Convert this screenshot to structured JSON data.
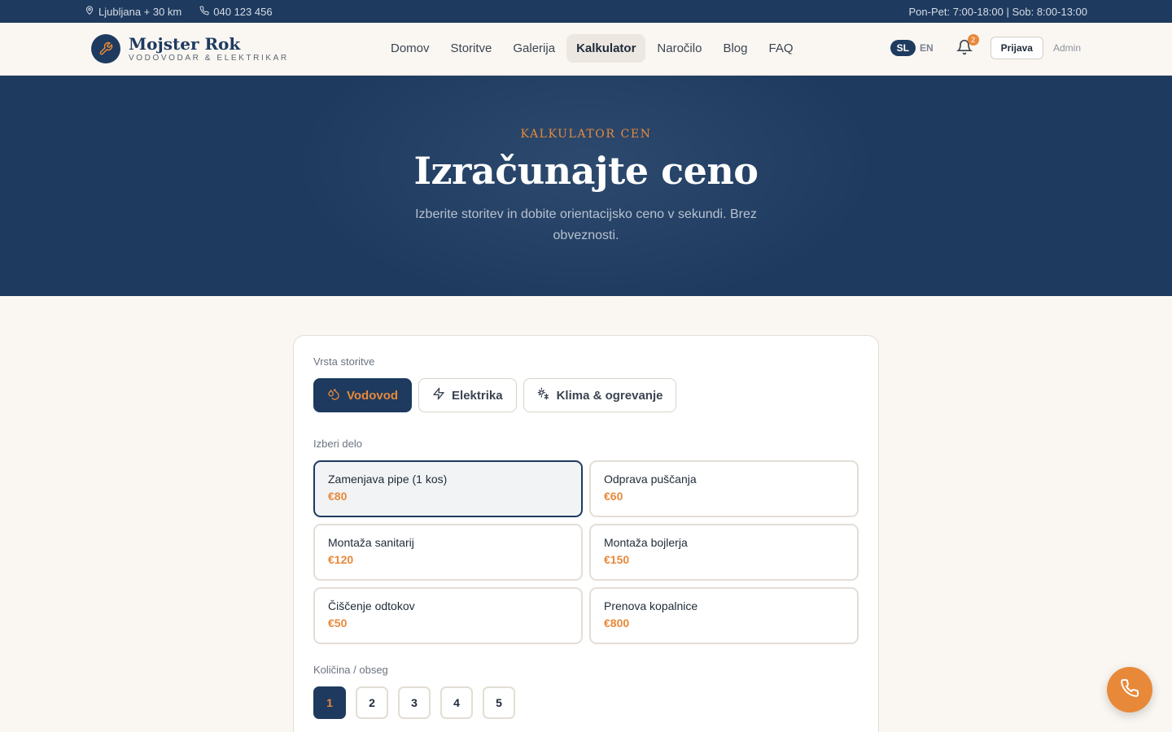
{
  "topbar": {
    "location": "Ljubljana + 30 km",
    "phone": "040 123 456",
    "hours": "Pon-Pet: 7:00-18:00 | Sob: 8:00-13:00"
  },
  "brand": {
    "name": "Mojster Rok",
    "subtitle": "VODOVODAR & ELEKTRIKAR"
  },
  "nav": {
    "items": [
      {
        "label": "Domov"
      },
      {
        "label": "Storitve"
      },
      {
        "label": "Galerija"
      },
      {
        "label": "Kalkulator",
        "active": true
      },
      {
        "label": "Naročilo"
      },
      {
        "label": "Blog"
      },
      {
        "label": "FAQ"
      }
    ]
  },
  "header": {
    "lang_sl": "SL",
    "lang_en": "EN",
    "notifications": "2",
    "login_label": "Prijava",
    "admin_label": "Admin"
  },
  "hero": {
    "eyebrow": "KALKULATOR CEN",
    "title": "Izračunajte ceno",
    "description": "Izberite storitev in dobite orientacijsko ceno v sekundi. Brez obveznosti."
  },
  "calculator": {
    "service_type_label": "Vrsta storitve",
    "types": [
      {
        "label": "Vodovod",
        "icon": "droplets-icon",
        "active": true
      },
      {
        "label": "Elektrika",
        "icon": "lightning-icon"
      },
      {
        "label": "Klima & ogrevanje",
        "icon": "sun-snow-icon"
      }
    ],
    "job_label": "Izberi delo",
    "jobs": [
      {
        "name": "Zamenjava pipe (1 kos)",
        "price": "€80",
        "active": true
      },
      {
        "name": "Odprava puščanja",
        "price": "€60"
      },
      {
        "name": "Montaža sanitarij",
        "price": "€120"
      },
      {
        "name": "Montaža bojlerja",
        "price": "€150"
      },
      {
        "name": "Čiščenje odtokov",
        "price": "€50"
      },
      {
        "name": "Prenova kopalnice",
        "price": "€800"
      }
    ],
    "quantity_label": "Količina / obseg",
    "quantities": [
      "1",
      "2",
      "3",
      "4",
      "5"
    ],
    "selected_quantity": "1"
  },
  "colors": {
    "primary": "#1e3a5f",
    "accent": "#e8893a",
    "background": "#faf7f2"
  }
}
